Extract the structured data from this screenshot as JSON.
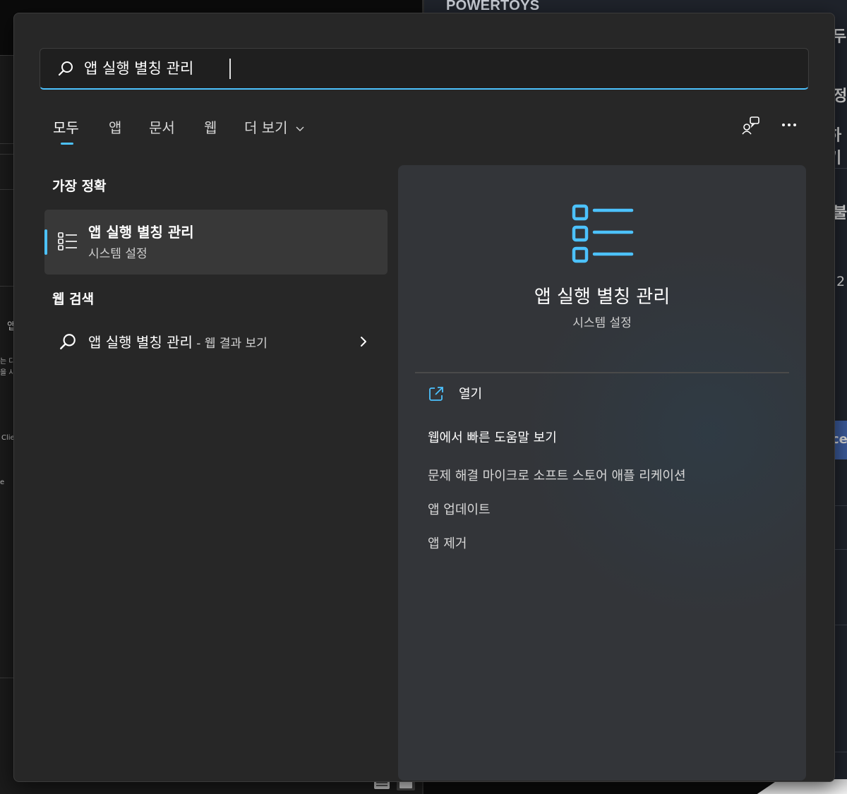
{
  "background": {
    "app_title": "POWERTOYS",
    "fragments": [
      "두",
      "정",
      "하기",
      "불",
      "2",
      "앱",
      "는 다",
      "을 사",
      "Clie",
      "e",
      "cel"
    ]
  },
  "search": {
    "icon": "search-icon",
    "query": "앱 실행 별칭 관리"
  },
  "tabs": {
    "items": [
      {
        "label": "모두",
        "active": true
      },
      {
        "label": "앱",
        "active": false
      },
      {
        "label": "문서",
        "active": false
      },
      {
        "label": "웹",
        "active": false
      },
      {
        "label": "더 보기",
        "active": false
      }
    ],
    "more_icon": "chevron-down-icon",
    "right_icons": [
      "people-feedback-icon",
      "more-options-icon"
    ]
  },
  "best_match": {
    "header": "가장 정확",
    "item": {
      "icon": "list-settings-icon",
      "title": "앱 실행 별칭 관리",
      "subtitle": "시스템 설정"
    }
  },
  "web_search": {
    "header": "웹 검색",
    "item": {
      "icon": "search-icon",
      "query": "앱 실행 별칭 관리",
      "suffix": " - 웹 결과 보기",
      "arrow_icon": "chevron-right-icon"
    }
  },
  "detail": {
    "icon": "list-settings-icon",
    "title": "앱 실행 별칭 관리",
    "subtitle": "시스템 설정",
    "open_label": "열기",
    "open_icon": "open-external-icon",
    "help_title": "웹에서 빠른 도움말 보기",
    "help_links": [
      "문제 해결 마이크로 소프트 스토어 애플 리케이션",
      "앱 업데이트",
      "앱 제거"
    ]
  },
  "colors": {
    "accent": "#4cc2ff",
    "flyout_bg": "#272727",
    "panel_bg": "#333539",
    "selected_bg": "#383838"
  }
}
